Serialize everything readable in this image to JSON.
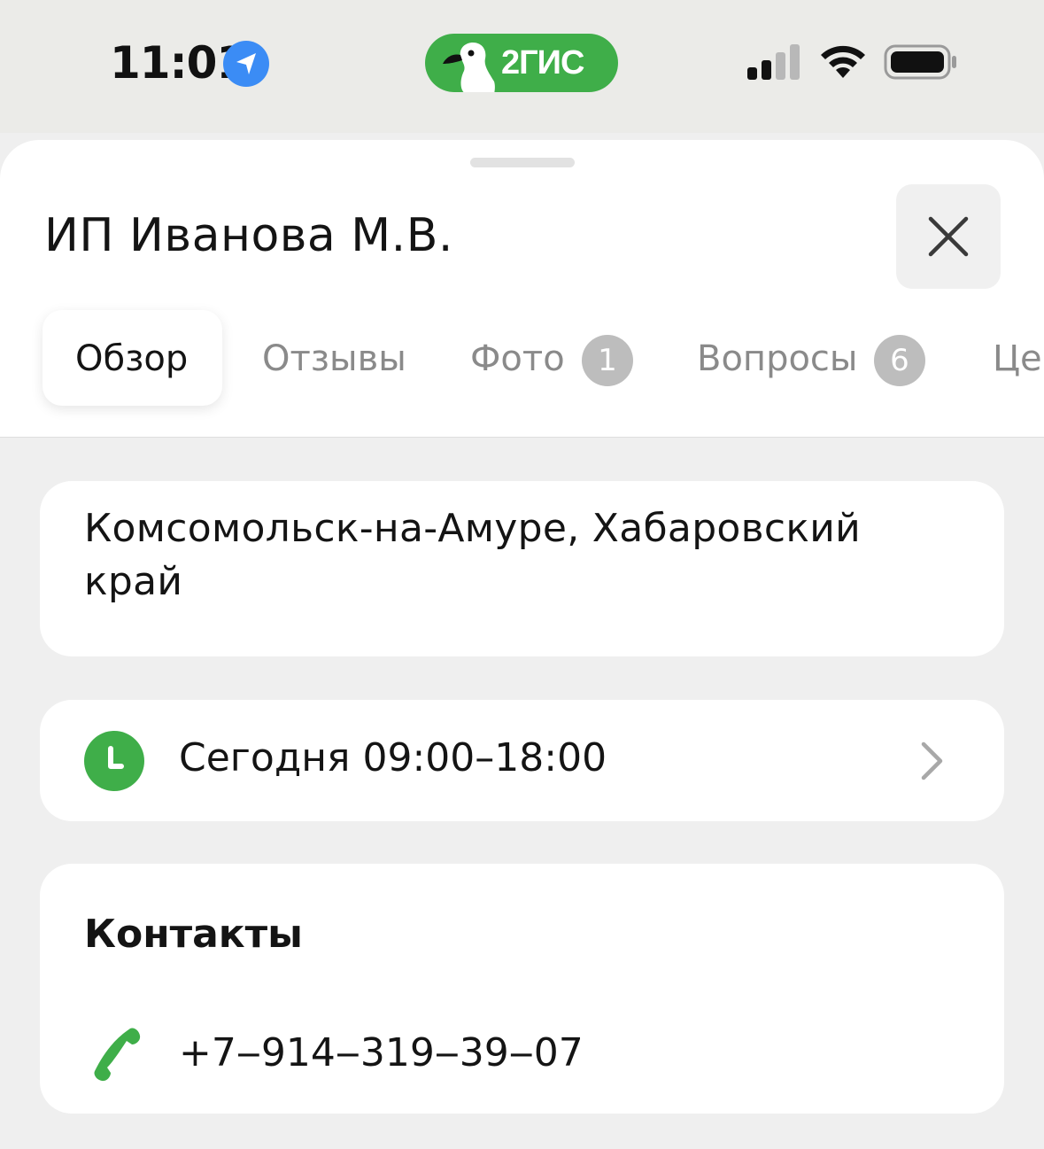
{
  "status_bar": {
    "time": "11:01",
    "app_badge_label": "2ГИС",
    "colors": {
      "badge_bg": "#3fae49",
      "location": "#3b8cf5"
    },
    "icons": [
      "location-arrow-icon",
      "duck-logo-icon",
      "cellular-signal-icon",
      "wifi-icon",
      "battery-icon"
    ]
  },
  "sheet": {
    "title": "ИП Иванова М.В.",
    "tabs": [
      {
        "label": "Обзор",
        "active": true
      },
      {
        "label": "Отзывы"
      },
      {
        "label": "Фото",
        "badge": "1"
      },
      {
        "label": "Вопросы",
        "badge": "6"
      },
      {
        "label": "Це"
      }
    ]
  },
  "address": {
    "text": "Комсомольск-на-Амуре, Хабаровский край"
  },
  "hours": {
    "text": "Сегодня 09:00–18:00",
    "icon": "clock-icon",
    "color": "#3fae49"
  },
  "contacts": {
    "title": "Контакты",
    "phone": "+7‒914‒319‒39‒07",
    "icon": "phone-icon"
  }
}
